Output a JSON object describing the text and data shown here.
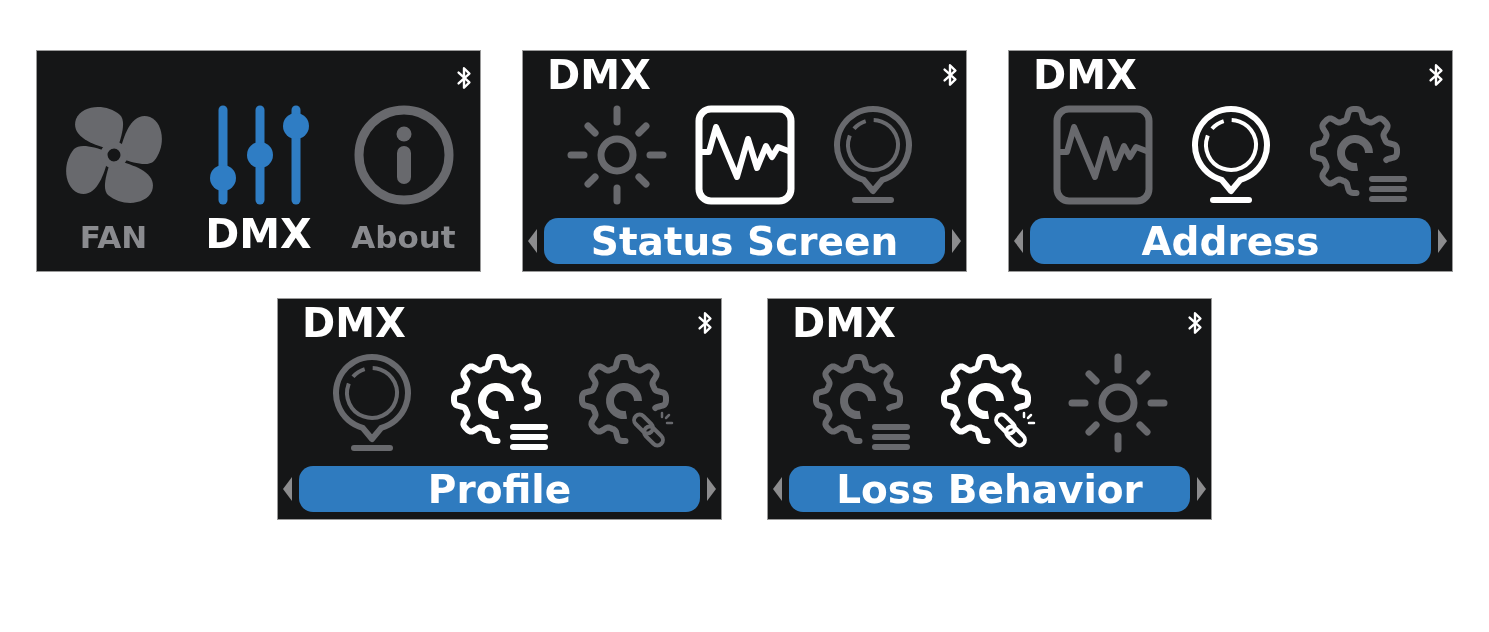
{
  "screens": [
    {
      "kind": "main_menu",
      "items": [
        {
          "kind": "fan",
          "label": "FAN",
          "selected": false
        },
        {
          "kind": "sliders",
          "label": "DMX",
          "selected": true
        },
        {
          "kind": "info",
          "label": "About",
          "selected": false
        }
      ]
    },
    {
      "kind": "submenu",
      "title": "DMX",
      "items": [
        {
          "kind": "sun",
          "selected": false
        },
        {
          "kind": "waveform",
          "selected": true
        },
        {
          "kind": "pin",
          "selected": false
        }
      ],
      "label": "Status Screen"
    },
    {
      "kind": "submenu",
      "title": "DMX",
      "items": [
        {
          "kind": "waveform",
          "selected": false
        },
        {
          "kind": "pin",
          "selected": true
        },
        {
          "kind": "gear_list",
          "selected": false
        }
      ],
      "label": "Address"
    },
    {
      "kind": "submenu",
      "title": "DMX",
      "items": [
        {
          "kind": "pin",
          "selected": false
        },
        {
          "kind": "gear_list",
          "selected": true
        },
        {
          "kind": "gear_link",
          "selected": false
        }
      ],
      "label": "Profile"
    },
    {
      "kind": "submenu",
      "title": "DMX",
      "items": [
        {
          "kind": "gear_list",
          "selected": false
        },
        {
          "kind": "gear_link",
          "selected": true
        },
        {
          "kind": "sun",
          "selected": false
        }
      ],
      "label": "Loss Behavior"
    }
  ]
}
